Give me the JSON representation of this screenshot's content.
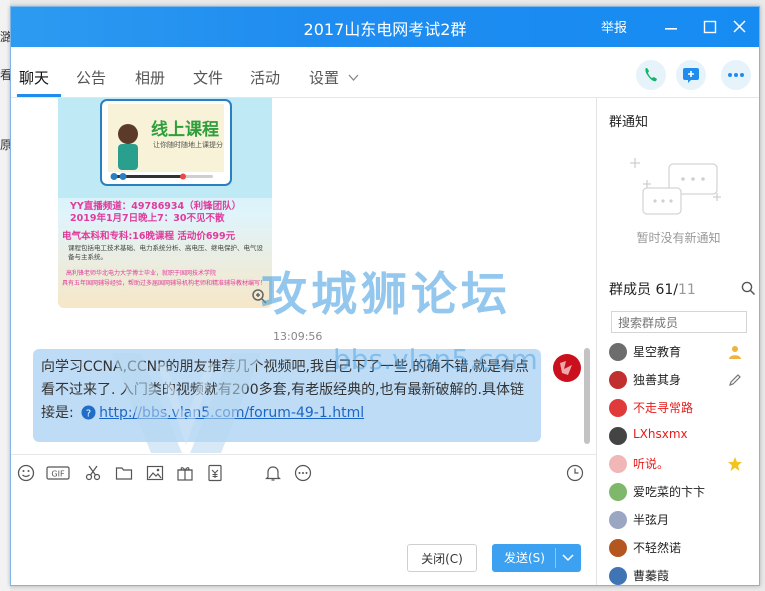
{
  "window": {
    "title": "2017山东电网考试2群",
    "report_label": "举报"
  },
  "tabs": [
    {
      "label": "聊天"
    },
    {
      "label": "公告"
    },
    {
      "label": "相册"
    },
    {
      "label": "文件"
    },
    {
      "label": "活动"
    },
    {
      "label": "设置"
    }
  ],
  "header_icons": [
    "phone-icon",
    "screen-share-icon",
    "more-icon"
  ],
  "poster": {
    "heading": "线上课程",
    "subheading": "让你随时随地上课提分",
    "line1": "YY直播频道：49786934（利锋团队）",
    "line2": "2019年1月7日晚上7：30不见不散",
    "line3": "电气本科和专科:16晚课程 活动价699元",
    "line4": "课程包括电工技术基础、电力系统分析、高电压、继电保护、电气设备与主系统。",
    "line5": "高利锋老师华北电力大学博士毕业，就职于国网技术学院",
    "line6": "具有五年国网辅导经验，帮助过多届国网辅导机构老师和精准辅导教材编写！"
  },
  "chat": {
    "timestamp": "13:09:56",
    "message_text": "向学习CCNA,CCNP的朋友推荐几个视频吧,我自己下了一些,的确不错,就是有点看不过来了. 入门类的视频就有200多套,有老版经典的,也有最新破解的.具体链接是:",
    "message_link": "http://bbs.vlan5.com/forum-49-1.html"
  },
  "watermark": {
    "title": "攻城狮论坛",
    "url": "bbs.vlan5.com"
  },
  "toolbar_icons": [
    "emoji-icon",
    "gif-icon",
    "scissors-icon",
    "folder-icon",
    "image-icon",
    "gift-icon",
    "red-packet-icon",
    "bell-icon",
    "more-circle-icon",
    "clock-icon"
  ],
  "buttons": {
    "close_label": "关闭(C)",
    "send_label": "发送(S)"
  },
  "sidebar": {
    "notice_title": "群通知",
    "notice_empty": "暂时没有新通知",
    "members_title": "群成员 61/",
    "members_total": "11",
    "search_placeholder": "搜索群成员",
    "members": [
      {
        "name": "星空教育",
        "color": "#222222",
        "badge": "owner-icon"
      },
      {
        "name": "独善其身",
        "color": "#222222",
        "badge": "edit-icon"
      },
      {
        "name": "不走寻常路",
        "color": "#e81b1b",
        "badge": ""
      },
      {
        "name": "LXhsxmx",
        "color": "#e81b1b",
        "badge": ""
      },
      {
        "name": "听说。",
        "color": "#e81b1b",
        "badge": "star-icon"
      },
      {
        "name": "爱吃菜的卞卞",
        "color": "#222222",
        "badge": ""
      },
      {
        "name": "半弦月",
        "color": "#222222",
        "badge": ""
      },
      {
        "name": "不轻然诺",
        "color": "#222222",
        "badge": ""
      },
      {
        "name": "曹蓁葭",
        "color": "#222222",
        "badge": ""
      }
    ]
  },
  "colors": {
    "accent": "#1f8cf0",
    "bubble": "#bfdcf6",
    "link": "#1a66c8",
    "member_red": "#e81b1b"
  }
}
